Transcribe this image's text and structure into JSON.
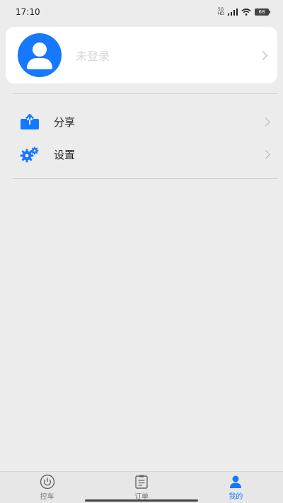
{
  "status_bar": {
    "time": "17:10",
    "network_top": "5G",
    "network_bottom": "HD",
    "battery": "68"
  },
  "profile": {
    "name": "未登录",
    "avatar_color": "#1677ff"
  },
  "menu": {
    "items": [
      {
        "label": "分享",
        "icon": "share-upload-icon"
      },
      {
        "label": "设置",
        "icon": "gear-icon"
      }
    ]
  },
  "tab_bar": {
    "tabs": [
      {
        "label": "控车",
        "icon": "power-icon"
      },
      {
        "label": "订单",
        "icon": "clipboard-icon"
      },
      {
        "label": "我的",
        "icon": "person-icon"
      }
    ],
    "active_index": 2
  },
  "colors": {
    "accent": "#1677ff",
    "background": "#ececec",
    "card": "#ffffff"
  }
}
